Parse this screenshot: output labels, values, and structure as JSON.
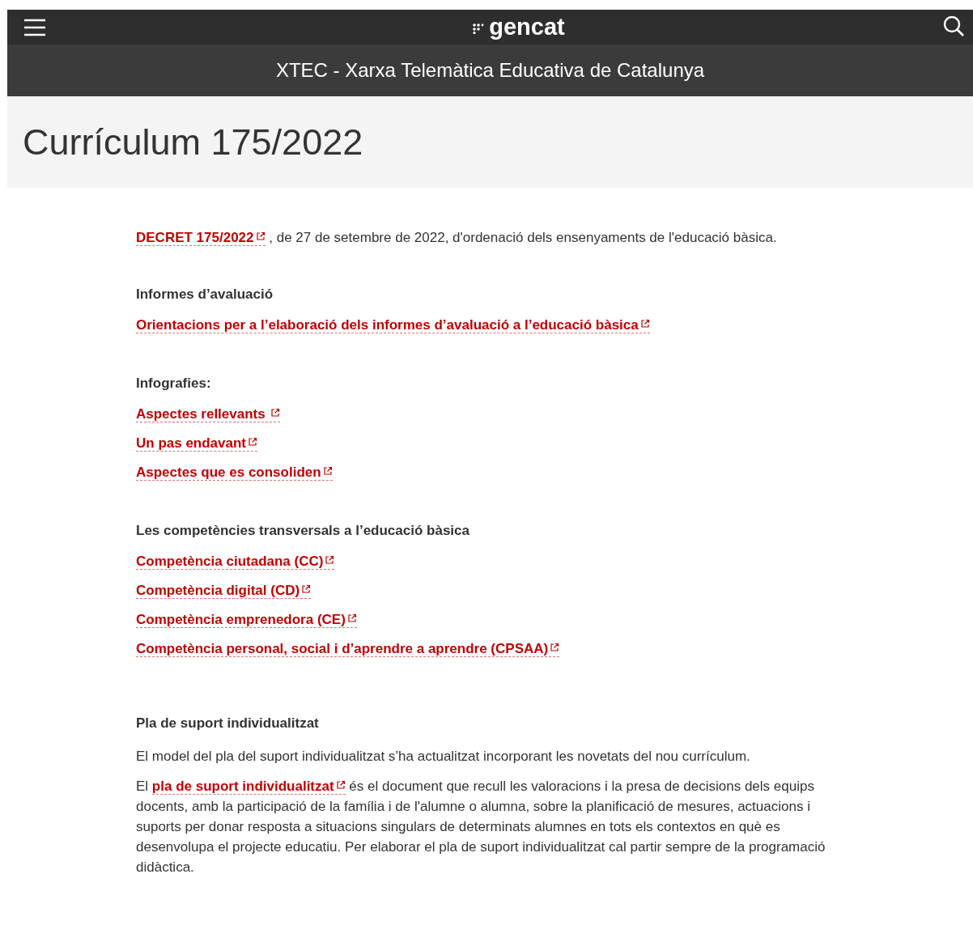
{
  "header": {
    "logo": "gencat",
    "site_title": "XTEC - Xarxa Telemàtica Educativa de Catalunya"
  },
  "page_title": "Currículum 175/2022",
  "intro": {
    "link": "DECRET 175/2022",
    "text": ", de 27 de setembre de 2022, d'ordenació dels ensenyaments de l'educació bàsica."
  },
  "sections": [
    {
      "heading": "Informes d’avaluació",
      "links": [
        "Orientacions per a l’elaboració dels informes d’avaluació a l’educació bàsica"
      ]
    },
    {
      "heading": "Infografies:",
      "links": [
        "Aspectes rellevants ",
        "Un pas endavant",
        "Aspectes que es consoliden"
      ]
    },
    {
      "heading": "Les competències transversals a l’educació bàsica",
      "links": [
        "Competència ciutadana (CC)",
        "Competència digital (CD)",
        "Competència emprenedora (CE)",
        "Competència personal, social i d’aprendre a aprendre (CPSAA)"
      ]
    },
    {
      "heading": "Pla de suport individualitzat",
      "paragraphs": [
        {
          "before": "El model del pla del suport individualitzat s’ha actualitzat incorporant les novetats del nou currículum."
        },
        {
          "before": "El ",
          "link": "pla de suport individualitzat",
          "after": " és el document que recull les valoracions i la presa de decisions dels equips docents, amb la participació de la família i de l'alumne o alumna, sobre la planificació de mesures, actuacions i suports per donar resposta a situacions singulars de determinats alumnes en tots els contextos en què es desenvolupa el projecte educatiu. Per elaborar el pla de suport individualitzat cal partir sempre de la programació didàctica."
        }
      ]
    }
  ]
}
